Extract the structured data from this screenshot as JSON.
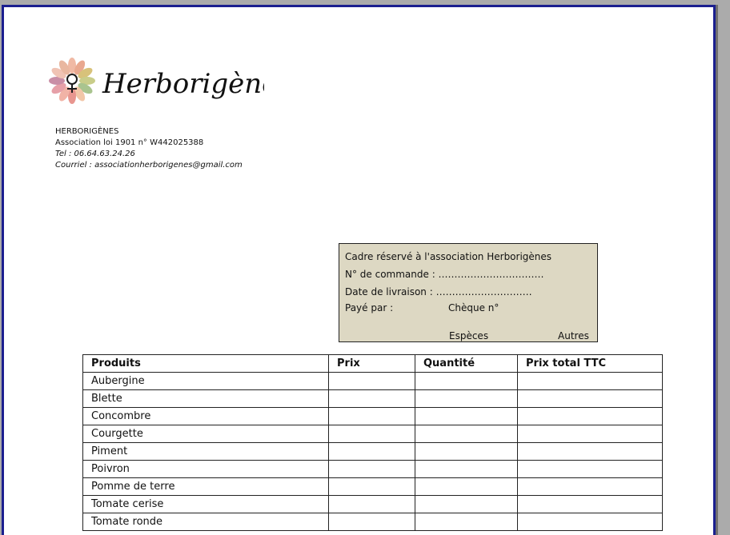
{
  "organization": {
    "logo_text": "Herborigènes",
    "name": "HERBORIGÈNES",
    "registration": "Association loi 1901 n° W442025388",
    "phone": "Tel : 06.64.63.24.26",
    "email": "Courriel : associationherborigenes@gmail.com"
  },
  "reserved_box": {
    "title": "Cadre réservé à l'association Herborigènes",
    "order_number": "N° de commande : ……………………………",
    "delivery_date": "Date de livraison : …………………………",
    "paid_by": "Payé par :",
    "cheque": "Chèque n°",
    "cash": "Espèces",
    "other": "Autres"
  },
  "product_table": {
    "headers": [
      "Produits",
      "Prix",
      "Quantité",
      "Prix total TTC"
    ],
    "rows": [
      "Aubergine",
      "Blette",
      "Concombre",
      "Courgette",
      "Piment",
      "Poivron",
      "Pomme de terre",
      "Tomate cerise",
      "Tomate ronde"
    ]
  },
  "colors": {
    "page_border": "#1b1f8f",
    "reserved_box_bg": "#ddd8c3",
    "window_bg": "#ababab"
  }
}
